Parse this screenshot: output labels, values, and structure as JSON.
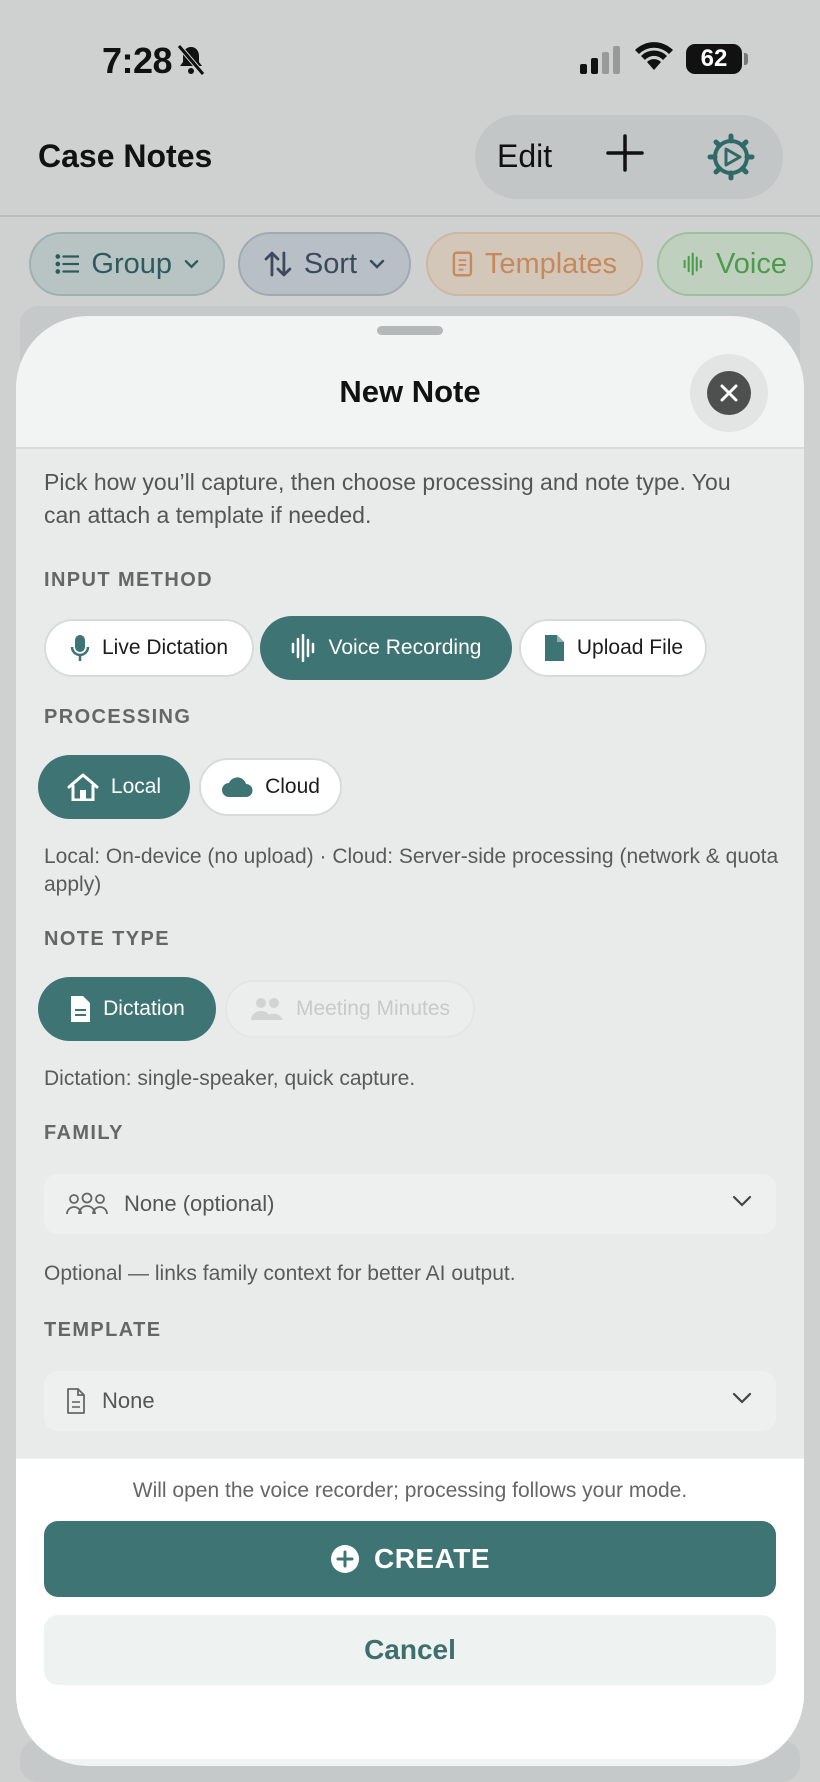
{
  "status_bar": {
    "time": "7:28",
    "battery": "62"
  },
  "header": {
    "title": "Case Notes",
    "edit_label": "Edit",
    "icons": [
      "plus-icon",
      "gear-icon"
    ]
  },
  "filter_chips": [
    {
      "label": "Group",
      "icon": "list-icon",
      "color": "#2f5a5c"
    },
    {
      "label": "Sort",
      "icon": "sort-arrows-icon",
      "color": "#3a4a5c"
    },
    {
      "label": "Templates",
      "icon": "template-doc-icon",
      "color": "#c8895a"
    },
    {
      "label": "Voice",
      "icon": "waveform-icon",
      "color": "#4c9a4c"
    }
  ],
  "sheet": {
    "title": "New Note",
    "intro": "Pick how you’ll capture, then choose processing and note type. You can attach a template if needed.",
    "input_method": {
      "label": "INPUT METHOD",
      "options": [
        {
          "label": "Live Dictation",
          "icon": "microphone-icon",
          "selected": false
        },
        {
          "label": "Voice Recording",
          "icon": "waveform-icon",
          "selected": true
        },
        {
          "label": "Upload File",
          "icon": "file-icon",
          "selected": false
        }
      ]
    },
    "processing": {
      "label": "PROCESSING",
      "options": [
        {
          "label": "Local",
          "icon": "house-icon",
          "selected": true
        },
        {
          "label": "Cloud",
          "icon": "cloud-icon",
          "selected": false
        }
      ],
      "hint": "Local: On-device (no upload) · Cloud: Server-side processing (network & quota apply)"
    },
    "note_type": {
      "label": "NOTE TYPE",
      "options": [
        {
          "label": "Dictation",
          "icon": "document-icon",
          "selected": true
        },
        {
          "label": "Meeting Minutes",
          "icon": "people-icon",
          "selected": false,
          "disabled": true
        }
      ],
      "hint": "Dictation: single-speaker, quick capture."
    },
    "family": {
      "label": "FAMILY",
      "value": "None (optional)",
      "hint": "Optional — links family context for better AI output."
    },
    "template": {
      "label": "TEMPLATE",
      "value": "None"
    },
    "footer": {
      "note": "Will open the voice recorder; processing follows your mode.",
      "create_label": "CREATE",
      "cancel_label": "Cancel"
    }
  },
  "colors": {
    "accent": "#3e7574",
    "sheet_background": "#f2f3f3"
  }
}
